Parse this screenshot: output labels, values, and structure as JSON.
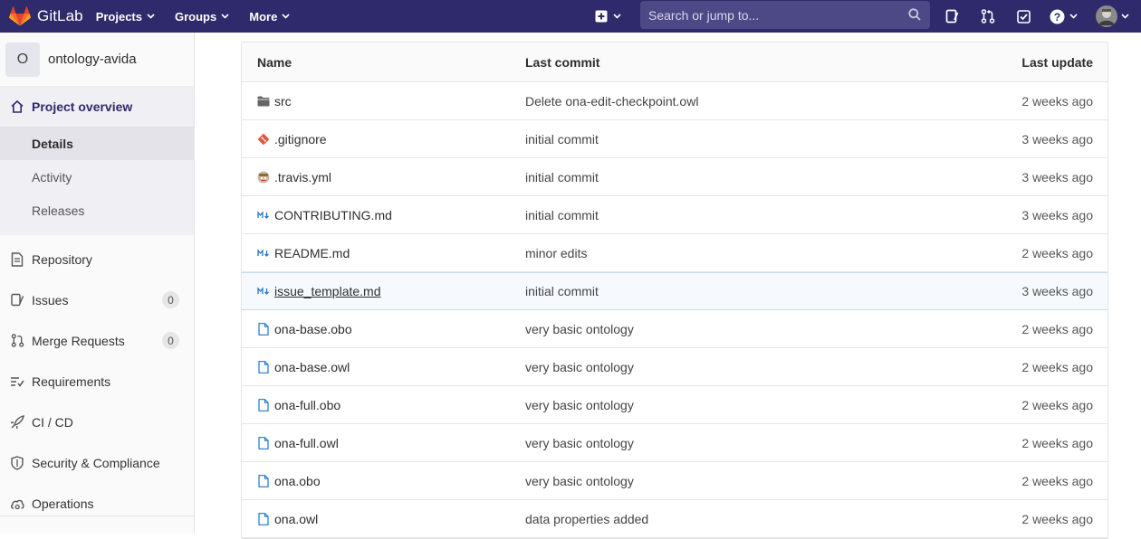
{
  "navbar": {
    "brand": "GitLab",
    "menu": [
      "Projects",
      "Groups",
      "More"
    ],
    "search_placeholder": "Search or jump to..."
  },
  "sidebar": {
    "project_initial": "O",
    "project_name": "ontology-avida",
    "overview_label": "Project overview",
    "overview_sub": [
      "Details",
      "Activity",
      "Releases"
    ],
    "items": [
      {
        "label": "Repository"
      },
      {
        "label": "Issues",
        "count": "0"
      },
      {
        "label": "Merge Requests",
        "count": "0"
      },
      {
        "label": "Requirements"
      },
      {
        "label": "CI / CD"
      },
      {
        "label": "Security & Compliance"
      },
      {
        "label": "Operations"
      }
    ]
  },
  "table": {
    "headers": [
      "Name",
      "Last commit",
      "Last update"
    ],
    "rows": [
      {
        "name": "src",
        "icon": "folder-icon",
        "commit": "Delete ona-edit-checkpoint.owl",
        "date": "2 weeks ago"
      },
      {
        "name": ".gitignore",
        "icon": "git-icon",
        "commit": "initial commit",
        "date": "3 weeks ago"
      },
      {
        "name": ".travis.yml",
        "icon": "travis-icon",
        "commit": "initial commit",
        "date": "3 weeks ago"
      },
      {
        "name": "CONTRIBUTING.md",
        "icon": "markdown-icon",
        "commit": "initial commit",
        "date": "3 weeks ago"
      },
      {
        "name": "README.md",
        "icon": "markdown-icon",
        "commit": "minor edits",
        "date": "2 weeks ago"
      },
      {
        "name": "issue_template.md",
        "icon": "markdown-icon",
        "commit": "initial commit",
        "date": "3 weeks ago"
      },
      {
        "name": "ona-base.obo",
        "icon": "file-icon",
        "commit": "very basic ontology",
        "date": "2 weeks ago"
      },
      {
        "name": "ona-base.owl",
        "icon": "file-icon",
        "commit": "very basic ontology",
        "date": "2 weeks ago"
      },
      {
        "name": "ona-full.obo",
        "icon": "file-icon",
        "commit": "very basic ontology",
        "date": "2 weeks ago"
      },
      {
        "name": "ona-full.owl",
        "icon": "file-icon",
        "commit": "very basic ontology",
        "date": "2 weeks ago"
      },
      {
        "name": "ona.obo",
        "icon": "file-icon",
        "commit": "very basic ontology",
        "date": "2 weeks ago"
      },
      {
        "name": "ona.owl",
        "icon": "file-icon",
        "commit": "data properties added",
        "date": "2 weeks ago"
      }
    ]
  },
  "colors": {
    "navbar": "#2f2a6b",
    "search_bg": "#4d4886",
    "accent_orange": "#e24329",
    "link_blue": "#1f78d1"
  }
}
